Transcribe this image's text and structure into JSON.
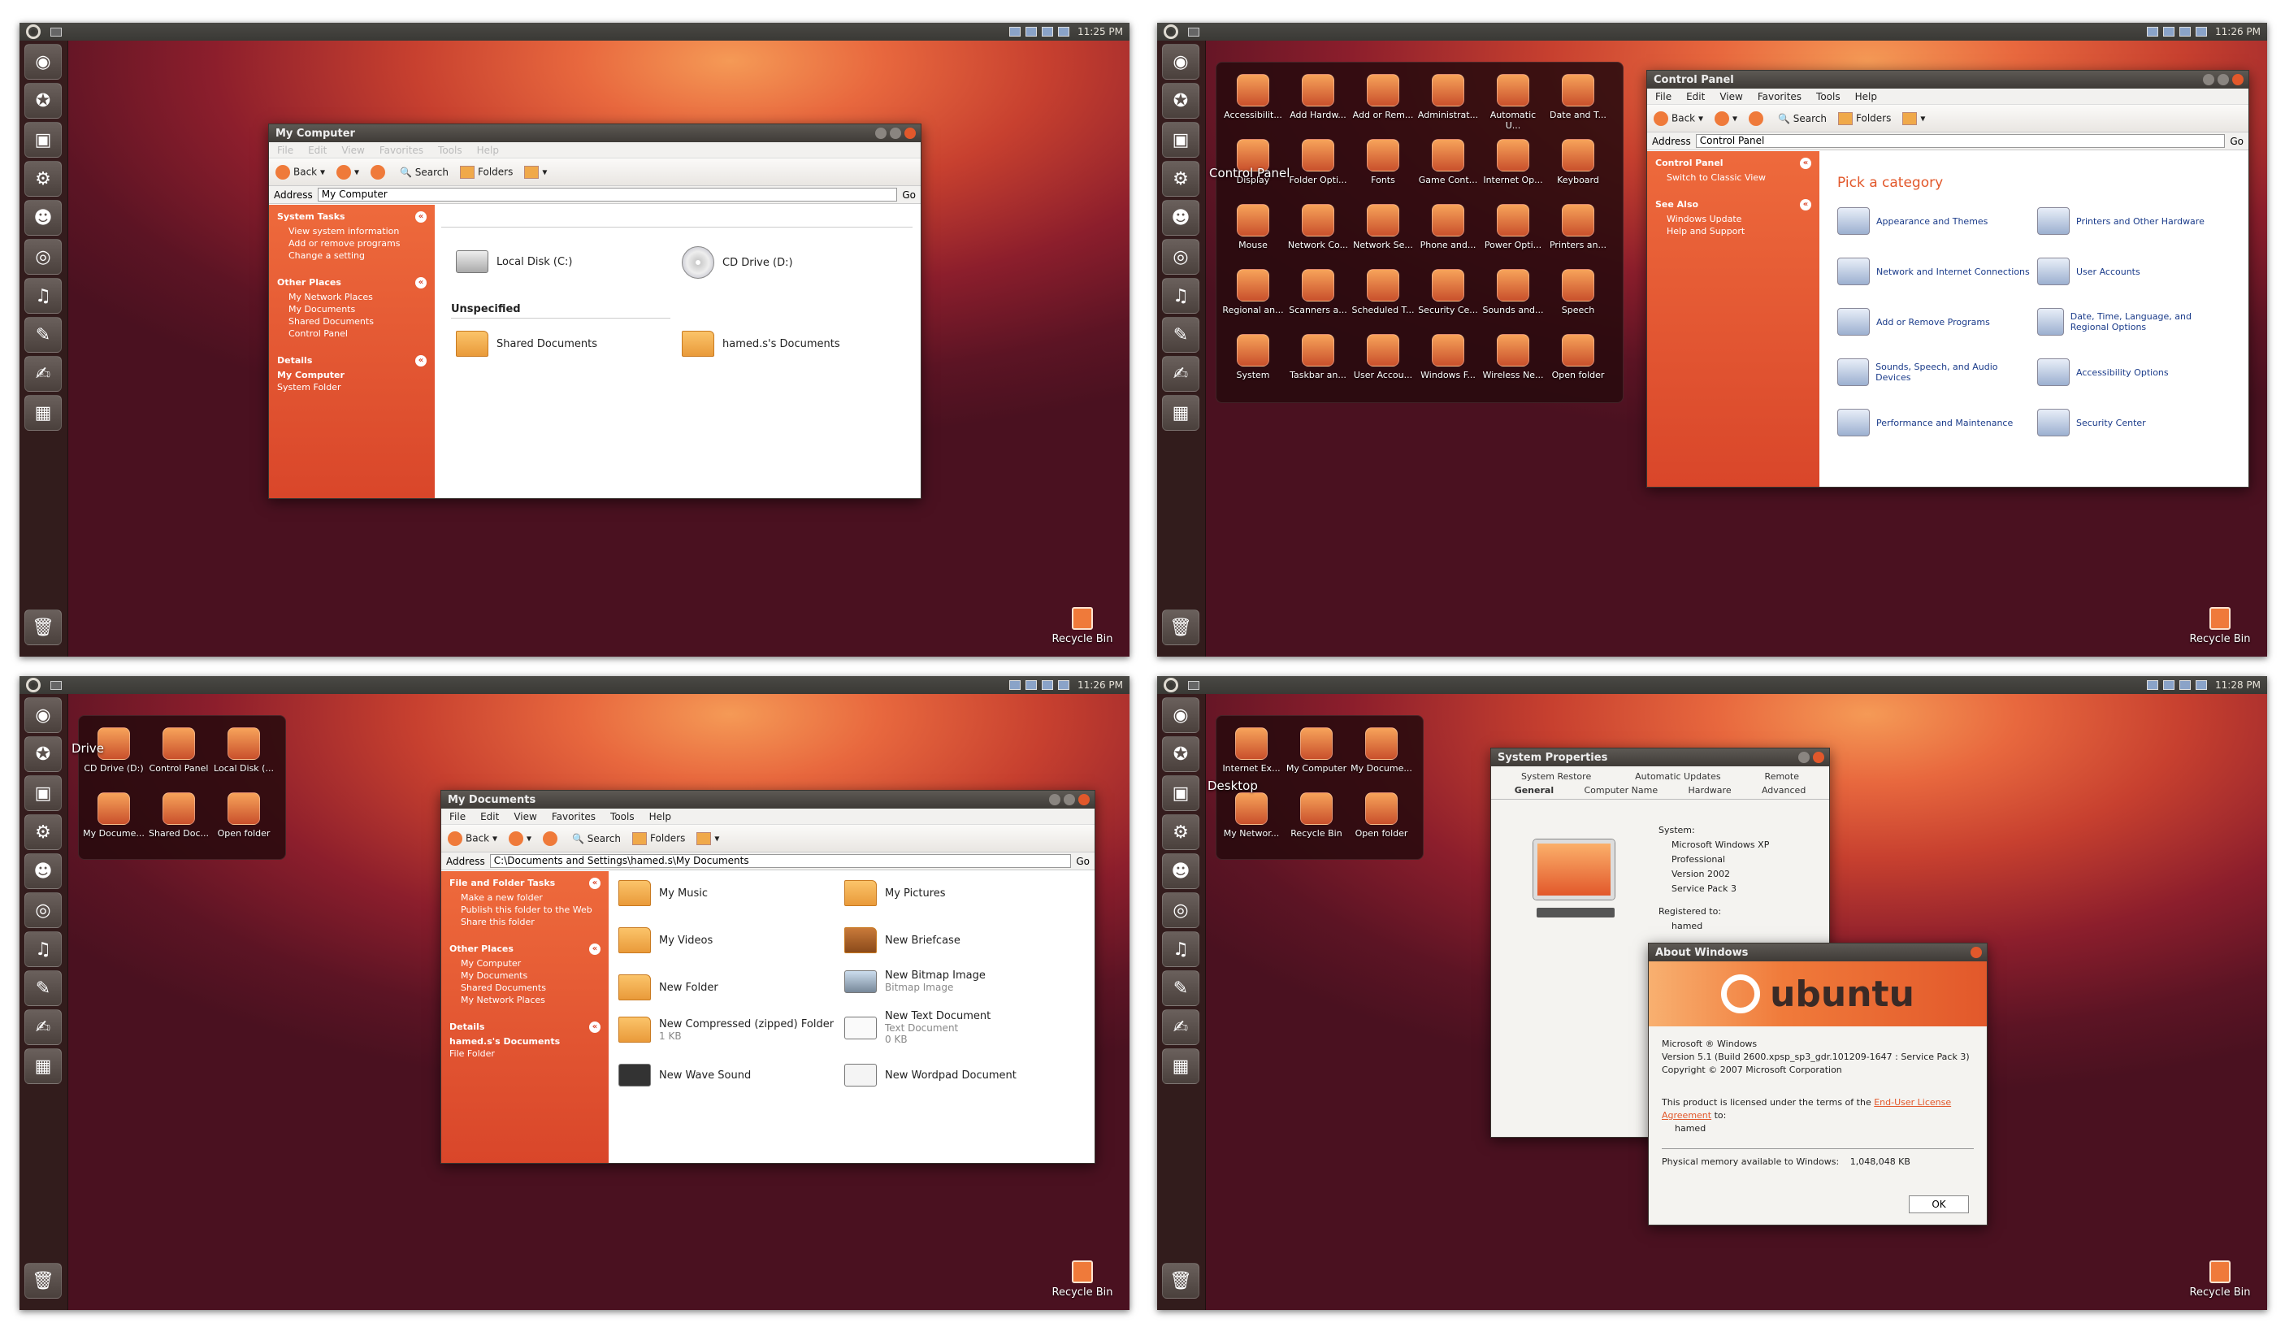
{
  "q1": {
    "clock": "11:25 PM",
    "recycle": "Recycle Bin",
    "win": {
      "title": "My Computer",
      "menu": [
        "File",
        "Edit",
        "View",
        "Favorites",
        "Tools",
        "Help"
      ],
      "back": "Back",
      "search": "Search",
      "folders": "Folders",
      "address_label": "Address",
      "address": "My Computer",
      "go": "Go"
    },
    "tasks": {
      "h1": "System Tasks",
      "t1": "View system information",
      "t2": "Add or remove programs",
      "t3": "Change a setting",
      "h2": "Other Places",
      "o1": "My Network Places",
      "o2": "My Documents",
      "o3": "Shared Documents",
      "o4": "Control Panel",
      "h3": "Details",
      "d1": "My Computer",
      "d2": "System Folder"
    },
    "items": {
      "local": "Local Disk (C:)",
      "cd": "CD Drive (D:)",
      "unspec": "Unspecified",
      "shared": "Shared Documents",
      "hamed": "hamed.s's Documents"
    }
  },
  "q2": {
    "clock": "11:26 PM",
    "recycle": "Recycle Bin",
    "dash_caption": "Control Panel",
    "dash": [
      "Accessibilit...",
      "Add Hardw...",
      "Add or Rem...",
      "Administrat...",
      "Automatic U...",
      "Date and T...",
      "Display",
      "Folder Opti...",
      "Fonts",
      "Game Cont...",
      "Internet Op...",
      "Keyboard",
      "Mouse",
      "Network Co...",
      "Network Se...",
      "Phone and...",
      "Power Opti...",
      "Printers an...",
      "Regional an...",
      "Scanners a...",
      "Scheduled T...",
      "Security Ce...",
      "Sounds and...",
      "Speech",
      "System",
      "Taskbar an...",
      "User Accou...",
      "Windows F...",
      "Wireless Ne...",
      "Open folder"
    ],
    "win": {
      "title": "Control Panel",
      "menu": [
        "File",
        "Edit",
        "View",
        "Favorites",
        "Tools",
        "Help"
      ],
      "back": "Back",
      "search": "Search",
      "folders": "Folders",
      "address_label": "Address",
      "address": "Control Panel",
      "go": "Go"
    },
    "side": {
      "h1": "Control Panel",
      "s1": "Switch to Classic View",
      "h2": "See Also",
      "a1": "Windows Update",
      "a2": "Help and Support"
    },
    "pick": "Pick a category",
    "cats": [
      "Appearance and Themes",
      "Printers and Other Hardware",
      "Network and Internet Connections",
      "User Accounts",
      "Add or Remove Programs",
      "Date, Time, Language, and Regional Options",
      "Sounds, Speech, and Audio Devices",
      "Accessibility Options",
      "Performance and Maintenance",
      "Security Center"
    ]
  },
  "q3": {
    "clock": "11:26 PM",
    "recycle": "Recycle Bin",
    "dash_caption": "Drive",
    "dash": [
      "CD Drive (D:)",
      "Control Panel",
      "Local Disk (...",
      "My Docume...",
      "Shared Doc...",
      "Open folder"
    ],
    "win": {
      "title": "My Documents",
      "menu": [
        "File",
        "Edit",
        "View",
        "Favorites",
        "Tools",
        "Help"
      ],
      "back": "Back",
      "search": "Search",
      "folders": "Folders",
      "address_label": "Address",
      "address": "C:\\Documents and Settings\\hamed.s\\My Documents",
      "go": "Go"
    },
    "side": {
      "h1": "File and Folder Tasks",
      "t1": "Make a new folder",
      "t2": "Publish this folder to the Web",
      "t3": "Share this folder",
      "h2": "Other Places",
      "o1": "My Computer",
      "o2": "My Documents",
      "o3": "Shared Documents",
      "o4": "My Network Places",
      "h3": "Details",
      "d1": "hamed.s's Documents",
      "d2": "File Folder"
    },
    "items": {
      "music": "My Music",
      "pictures": "My Pictures",
      "videos": "My Videos",
      "briefcase": "New Briefcase",
      "folder": "New Folder",
      "bitmap": "New Bitmap Image",
      "bitmap_sub": "Bitmap Image",
      "zip": "New Compressed (zipped) Folder",
      "zip_sub": "1 KB",
      "text": "New Text Document",
      "text_sub": "Text Document",
      "text_size": "0 KB",
      "wave": "New Wave Sound",
      "wordpad": "New Wordpad Document"
    }
  },
  "q4": {
    "clock": "11:28 PM",
    "recycle": "Recycle Bin",
    "dash_caption": "Desktop",
    "dash": [
      "Internet Ex...",
      "My Computer",
      "My Docume...",
      "My Networ...",
      "Recycle Bin",
      "Open folder"
    ],
    "sys": {
      "title": "System Properties",
      "tabs_top": [
        "System Restore",
        "Automatic Updates",
        "Remote"
      ],
      "tabs": [
        "General",
        "Computer Name",
        "Hardware",
        "Advanced"
      ],
      "system_label": "System:",
      "os": "Microsoft Windows XP",
      "edition": "Professional",
      "version": "Version 2002",
      "sp": "Service Pack 3",
      "reg_label": "Registered to:",
      "user": "hamed"
    },
    "about": {
      "title": "About Windows",
      "brand": "ubuntu",
      "l1": "Microsoft ® Windows",
      "l2": "Version 5.1 (Build 2600.xpsp_sp3_gdr.101209-1647 : Service Pack 3)",
      "l3": "Copyright © 2007 Microsoft Corporation",
      "lic1": "This product is licensed under the terms of the",
      "lic_link": "End-User License Agreement",
      "lic2": "to:",
      "user": "hamed",
      "mem_label": "Physical memory available to Windows:",
      "mem": "1,048,048 KB",
      "ok": "OK"
    }
  }
}
